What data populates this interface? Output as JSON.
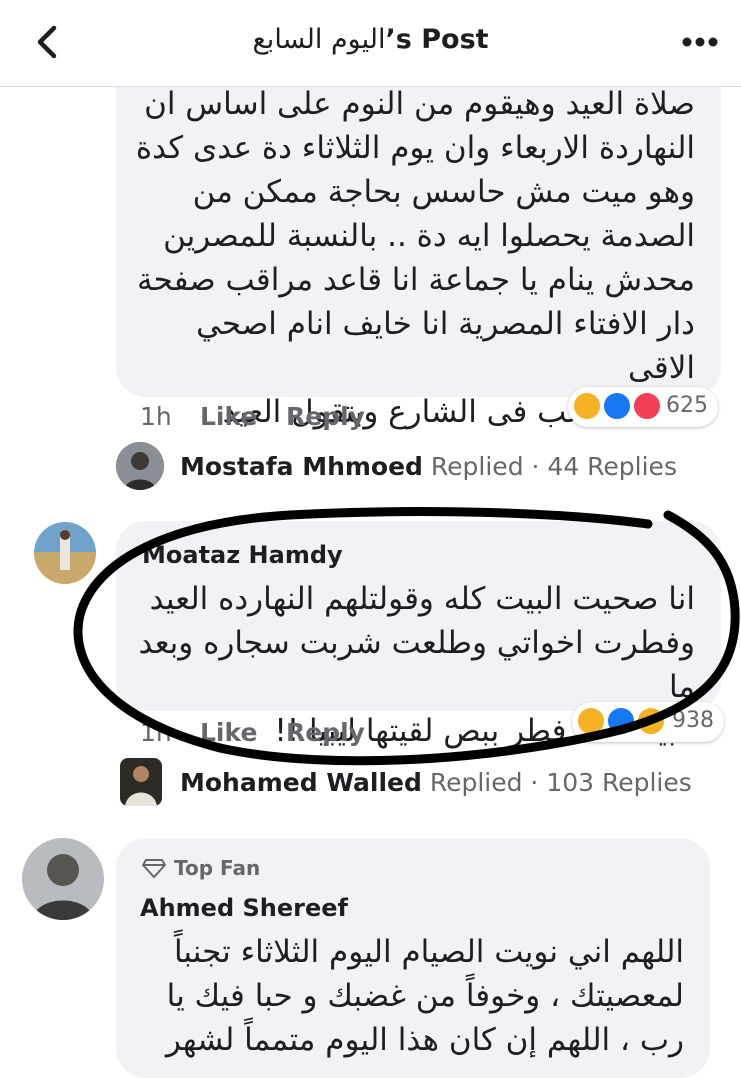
{
  "header": {
    "title_ar": "اليوم السابع",
    "title_suffix": "’s Post"
  },
  "comment1": {
    "lines": [
      "صلاة العيد وهيقوم من النوم على اساس ان",
      "النهاردة الاربعاء وان يوم الثلاثاء دة عدى كدة",
      "وهو ميت مش حاسس بحاجة ممكن من",
      "الصدمة يحصلوا ايه دة .. بالنسبة للمصرين",
      "محدش ينام يا جماعة انا قاعد مراقب صفحة",
      "دار الافتاء المصرية انا خايف انام اصحي الاقى",
      "العيال بتلعب فى الشارع وبتقول العيد"
    ],
    "time": "1h",
    "like": "Like",
    "reply": "Reply",
    "reaction_count": "625",
    "reactions": [
      "haha",
      "like",
      "love"
    ],
    "reply_summary": {
      "name": "Mostafa Mhmoed",
      "action": "Replied",
      "count": "· 44 Replies"
    }
  },
  "comment2": {
    "author": "Moataz Hamdy",
    "lines": [
      "انا صحيت البيت كله وقولتلهم النهارده العيد",
      "وفطرت اخواتي وطلعت شربت سجاره وبعد ما",
      "البيت كله فطر ببص لقيتها ليبيا !!"
    ],
    "time": "1h",
    "like": "Like",
    "reply": "Reply",
    "reaction_count": "938",
    "reactions": [
      "haha",
      "like",
      "wow"
    ],
    "reply_summary": {
      "name": "Mohamed Walled",
      "action": "Replied",
      "count": "· 103 Replies"
    }
  },
  "comment3": {
    "badge": "Top Fan",
    "author": "Ahmed Shereef",
    "lines": [
      "اللهم اني نويت الصيام اليوم الثلاثاء تجنباً",
      "لمعصيتك ، وخوفاً من غضبك و حبا فيك يا",
      "رب ، اللهم إن كان هذا اليوم متمماً لشهر"
    ]
  },
  "colors": {
    "bubble": "#f0f2f5",
    "muted": "#65676b",
    "like_blue": "#1877f2",
    "love_red": "#f33e58",
    "haha_yellow": "#f7b125",
    "annotation_ink": "#000000"
  }
}
